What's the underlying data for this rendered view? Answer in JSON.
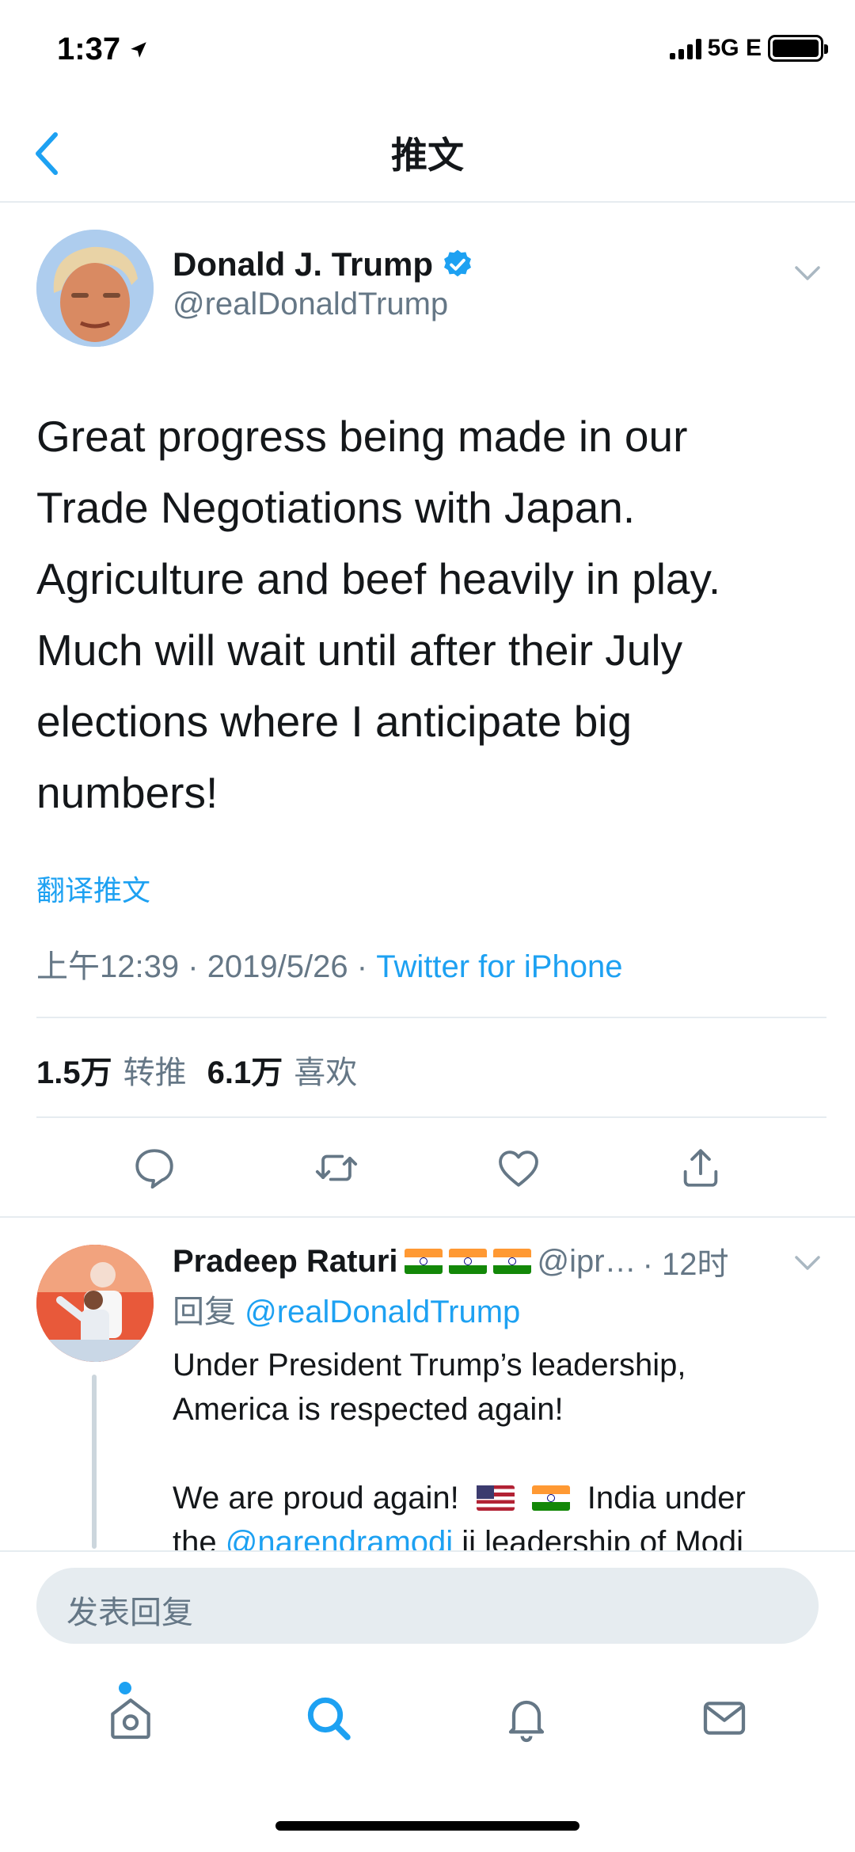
{
  "status_bar": {
    "time": "1:37",
    "network": "5G E"
  },
  "nav": {
    "title": "推文"
  },
  "tweet": {
    "author_name": "Donald J. Trump",
    "handle": "@realDonaldTrump",
    "text": "Great progress being made in our\nTrade Negotiations with Japan.\nAgriculture and beef heavily in play.\nMuch will wait until after their July\nelections where I anticipate big\nnumbers!",
    "translate_label": "翻译推文",
    "time": "上午12:39",
    "date": "2019/5/26",
    "separator": "·",
    "source": "Twitter for iPhone",
    "retweets": "1.5万",
    "retweets_label": "转推",
    "likes": "6.1万",
    "likes_label": "喜欢"
  },
  "reply": {
    "author_name": "Pradeep Raturi",
    "handle_trunc": "@ipr…",
    "time_ago": "· 12时",
    "reply_label": "回复",
    "reply_to": "@realDonaldTrump",
    "line1": "Under President Trump’s leadership,",
    "line2": "America is respected again!",
    "line3_a": "We are proud again!",
    "line3_b": "India under",
    "line4_a": "the",
    "line4_mention": "@narendramodi",
    "line4_b": "ji leadership of Modi"
  },
  "compose": {
    "placeholder": "发表回复"
  },
  "colors": {
    "accent": "#1da1f2",
    "muted": "#657786",
    "text": "#14171a"
  },
  "icons": [
    "back-chevron-icon",
    "verified-badge-icon",
    "chevron-down-icon",
    "reply-icon",
    "retweet-icon",
    "like-icon",
    "share-icon",
    "home-icon",
    "search-icon",
    "notifications-icon",
    "messages-icon"
  ]
}
